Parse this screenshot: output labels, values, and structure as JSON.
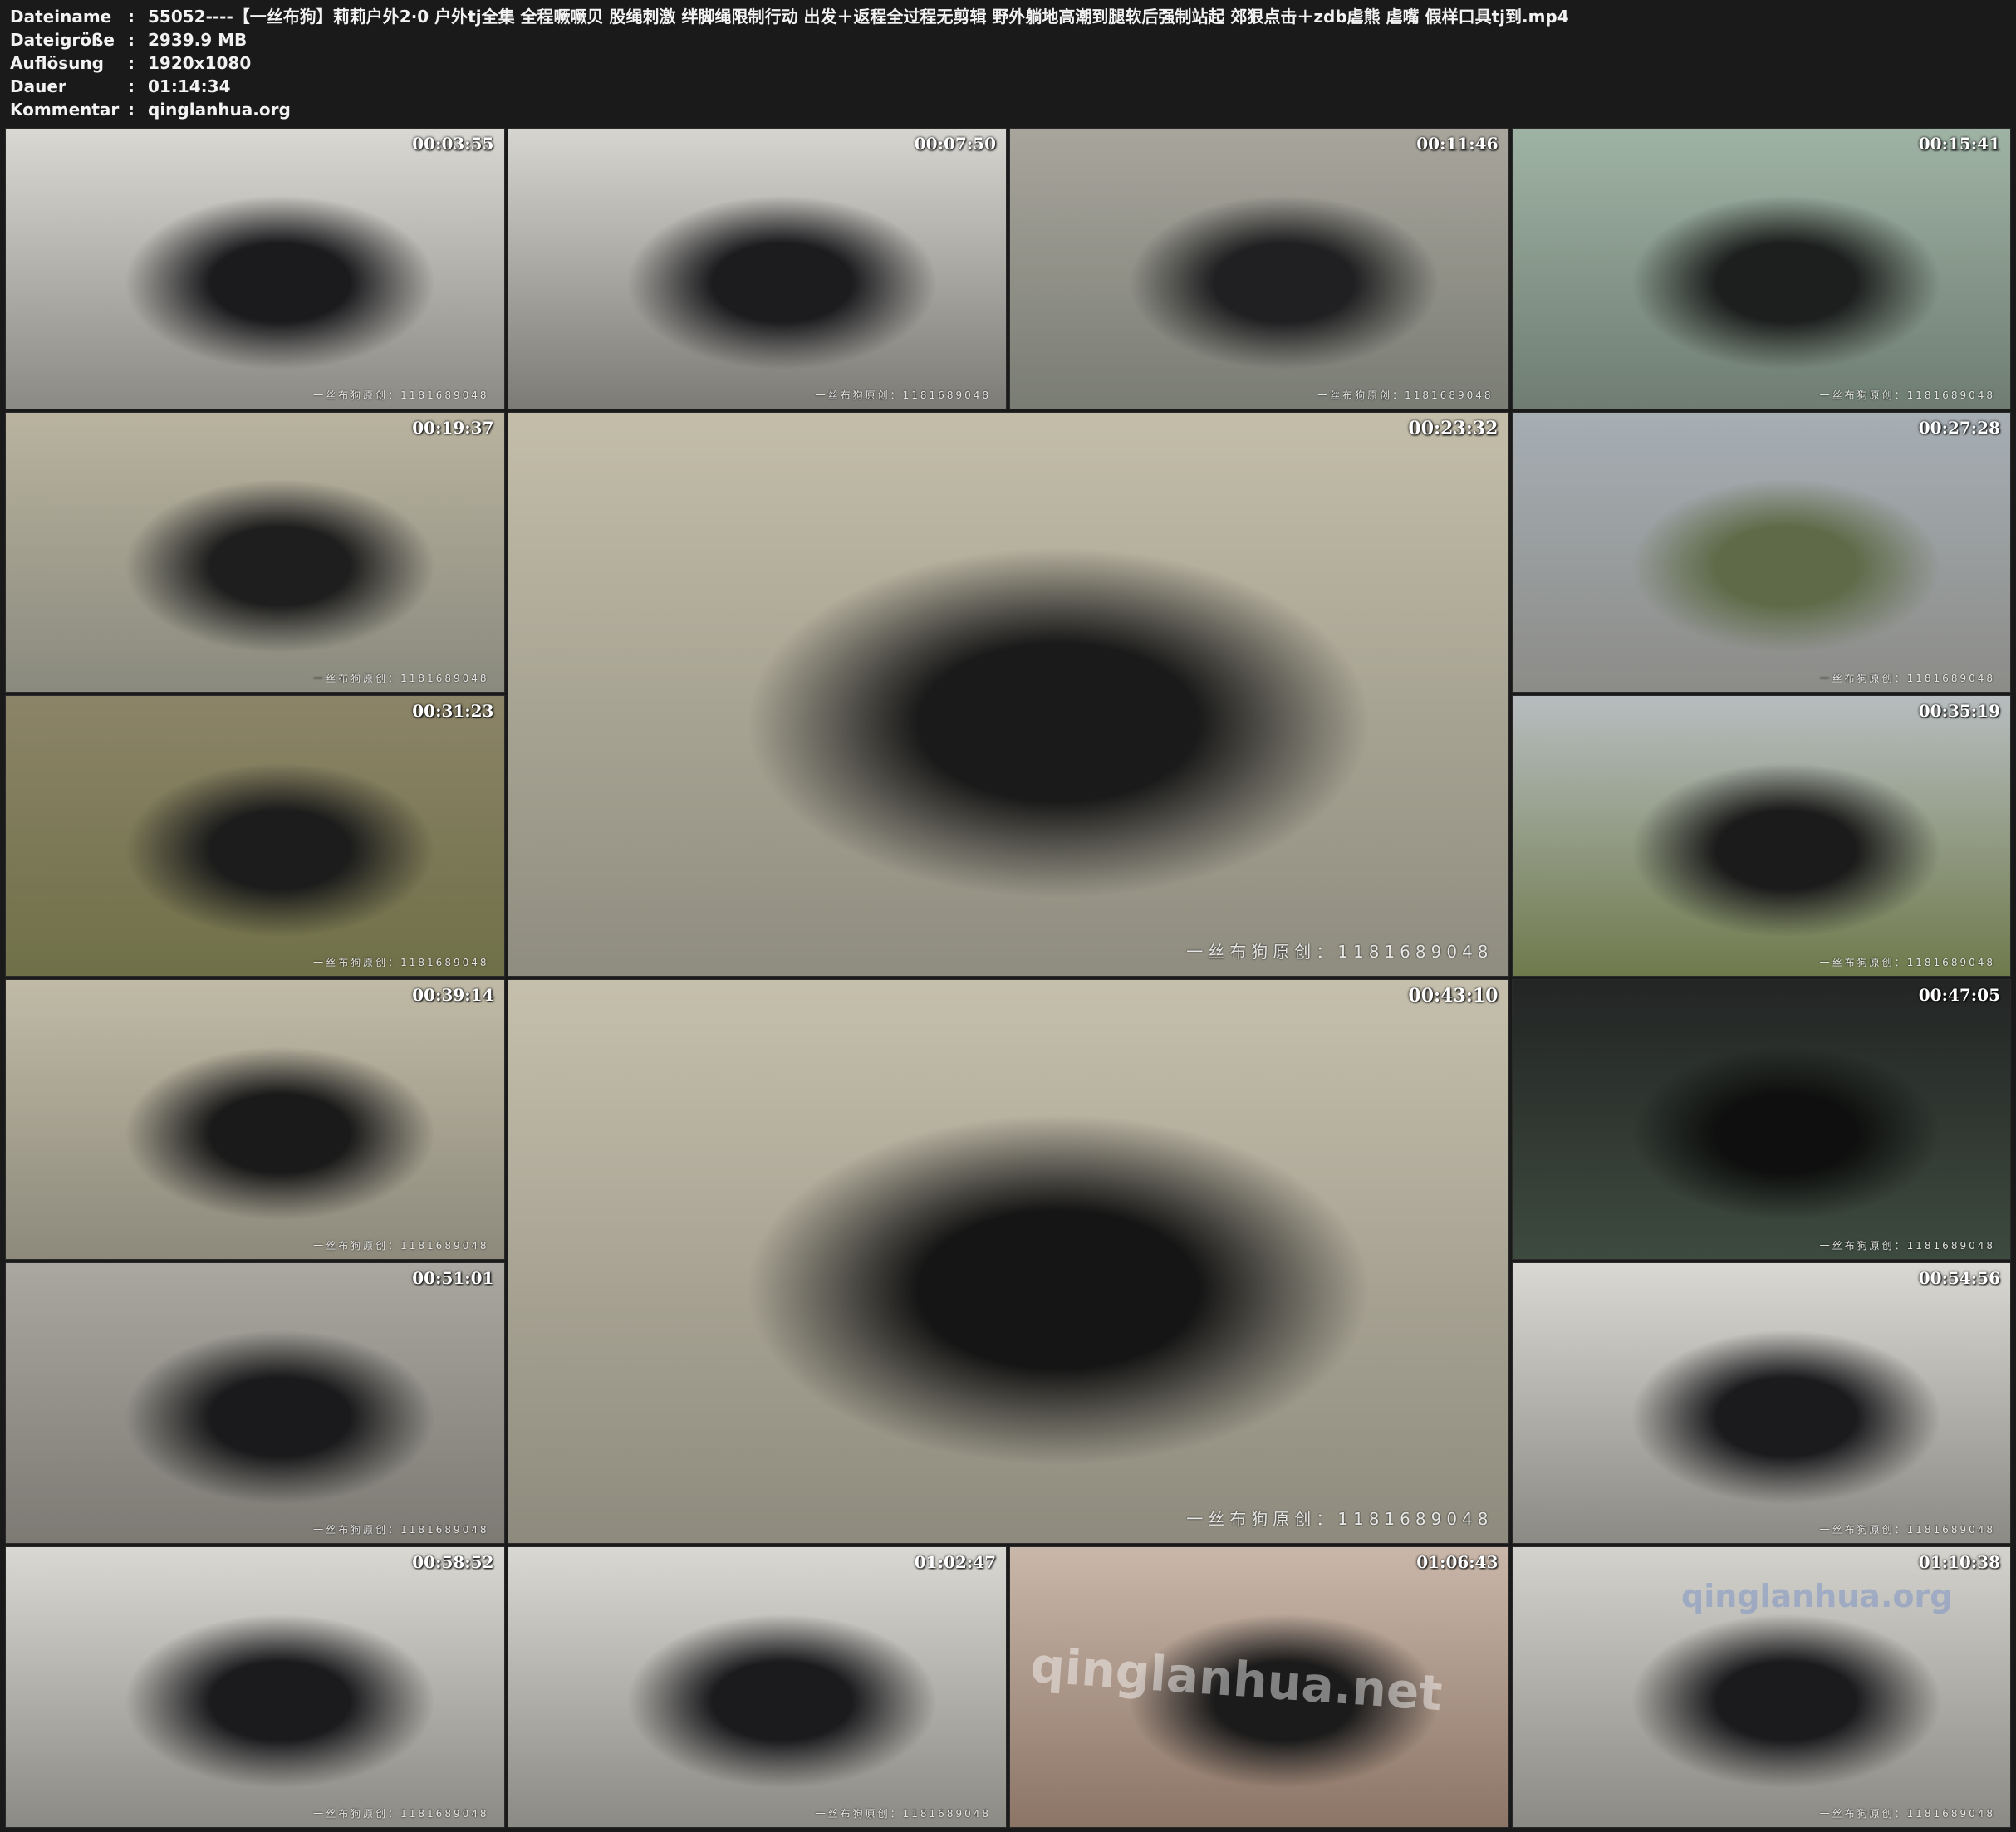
{
  "header": {
    "rows": [
      {
        "label": "Dateiname",
        "sep": ":",
        "value": "55052----【一丝布狗】莉莉户外2·0 户外tj全集 全程噘噘贝 股绳刺激 绊脚绳限制行动 出发＋返程全过程无剪辑 野外躺地高潮到腿软后强制站起 郊狠点击＋zdb虐熊 虐嘴 假样口具tj到.mp4"
      },
      {
        "label": "Dateigröße",
        "sep": ":",
        "value": "2939.9 MB"
      },
      {
        "label": "Auflösung",
        "sep": ":",
        "value": "1920x1080"
      },
      {
        "label": "Dauer",
        "sep": ":",
        "value": "01:14:34"
      },
      {
        "label": "Kommentar",
        "sep": ":",
        "value": "qinglanhua.org"
      }
    ]
  },
  "thumbnails": [
    {
      "time": "00:03:55",
      "watermark": "一丝布狗原创：1181689048",
      "palette": [
        "#d9d8d3",
        "#1b1b1e",
        "#8c8a84"
      ]
    },
    {
      "time": "00:07:50",
      "watermark": "一丝布狗原创：1181689048",
      "palette": [
        "#d6d5d0",
        "#1c1c1f",
        "#7d7b76"
      ]
    },
    {
      "time": "00:11:46",
      "watermark": "一丝布狗原创：1181689048",
      "palette": [
        "#a8a59c",
        "#202022",
        "#7a7d74"
      ]
    },
    {
      "time": "00:15:41",
      "watermark": "一丝布狗原创：1181689048",
      "palette": [
        "#9fb3a4",
        "#1d1f1e",
        "#6f7d72"
      ]
    },
    {
      "time": "00:19:37",
      "watermark": "一丝布狗原创：1181689048",
      "palette": [
        "#b9b39f",
        "#1e1e1e",
        "#8a8a7e"
      ]
    },
    {
      "time": "00:23:32",
      "watermark": "一丝布狗原创：1181689048",
      "palette": [
        "#c3bda9",
        "#1a1a1a",
        "#8f8d80"
      ]
    },
    {
      "time": "00:27:28",
      "watermark": "一丝布狗原创：1181689048",
      "palette": [
        "#a6aeb4",
        "#5f6a48",
        "#8c8c88"
      ]
    },
    {
      "time": "00:31:23",
      "watermark": "一丝布狗原创：1181689048",
      "palette": [
        "#8c8468",
        "#1c1c1c",
        "#6f7048"
      ]
    },
    {
      "time": "00:35:19",
      "watermark": "一丝布狗原创：1181689048",
      "palette": [
        "#b7bdbf",
        "#1b1b1b",
        "#6f7a4c"
      ]
    },
    {
      "time": "00:39:14",
      "watermark": "一丝布狗原创：1181689048",
      "palette": [
        "#c0baa6",
        "#1a1a1a",
        "#8d8a7c"
      ]
    },
    {
      "time": "00:43:10",
      "watermark": "一丝布狗原创：1181689048",
      "palette": [
        "#c5bfac",
        "#151515",
        "#8e8b7e"
      ]
    },
    {
      "time": "00:47:05",
      "watermark": "一丝布狗原创：1181689048",
      "palette": [
        "#232524",
        "#0e0f0e",
        "#3d4a3f"
      ]
    },
    {
      "time": "00:51:01",
      "watermark": "一丝布狗原创：1181689048",
      "palette": [
        "#a9a79f",
        "#1a1a1c",
        "#7c7a73"
      ]
    },
    {
      "time": "00:54:56",
      "watermark": "一丝布狗原创：1181689048",
      "palette": [
        "#d9d8d3",
        "#1b1b1e",
        "#8c8a84"
      ]
    },
    {
      "time": "00:58:52",
      "watermark": "一丝布狗原创：1181689048",
      "palette": [
        "#d9d8d3",
        "#1b1b1e",
        "#8c8a84"
      ]
    },
    {
      "time": "01:02:47",
      "watermark": "一丝布狗原创：1181689048",
      "palette": [
        "#d9d8d3",
        "#1b1b1e",
        "#8c8a84"
      ]
    },
    {
      "time": "01:06:43",
      "watermark": "",
      "palette": [
        "#c9b7aa",
        "#1b1b1b",
        "#8c7566"
      ]
    },
    {
      "time": "01:10:38",
      "watermark": "一丝布狗原创：1181689048",
      "palette": [
        "#d4d2cc",
        "#1b1b1e",
        "#8c8a84"
      ]
    }
  ],
  "site_watermarks": [
    "qinglanhua.net",
    "qinglanhua.org"
  ]
}
